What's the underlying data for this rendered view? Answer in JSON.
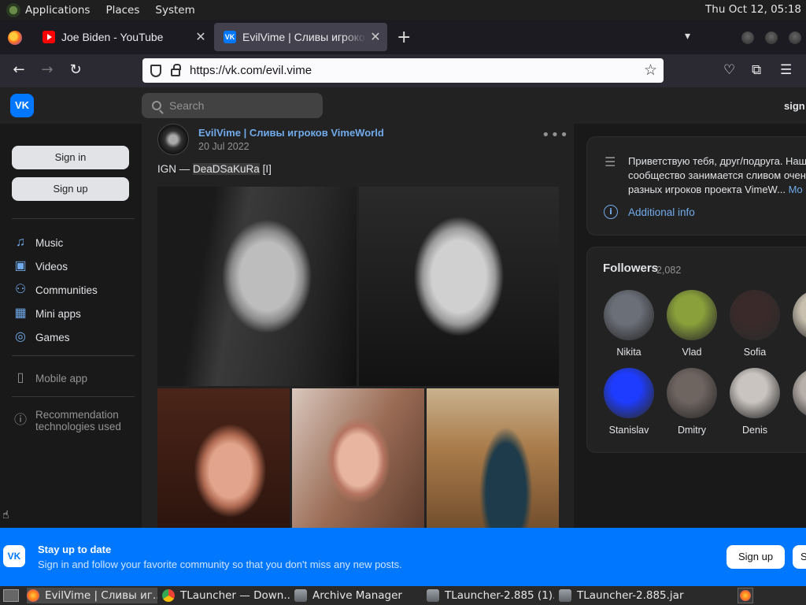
{
  "panel": {
    "menus": [
      "Applications",
      "Places",
      "System"
    ],
    "clock": "Thu Oct 12, 05:18"
  },
  "browser": {
    "tabs": [
      {
        "title": "Joe Biden - YouTube"
      },
      {
        "title": "EvilVime | Сливы игроков VimeWorld"
      }
    ],
    "url": "https://vk.com/evil.vime"
  },
  "vk": {
    "logo": "VK",
    "search_placeholder": "Search",
    "header_sign_in": "sign in",
    "sidebar": {
      "sign_in": "Sign in",
      "sign_up": "Sign up",
      "nav": [
        {
          "label": "Music",
          "icon": "music-icon"
        },
        {
          "label": "Videos",
          "icon": "video-icon"
        },
        {
          "label": "Communities",
          "icon": "users-icon"
        },
        {
          "label": "Mini apps",
          "icon": "grid-icon"
        },
        {
          "label": "Games",
          "icon": "gamepad-icon"
        }
      ],
      "mobile_app": "Mobile app",
      "recommendation": "Recommendation technologies used"
    },
    "post": {
      "author": "EvilVime | Сливы игроков VimeWorld",
      "date": "20 Jul 2022",
      "text_prefix": "IGN — ",
      "text_highlight": "DeaDSaKuRa",
      "text_suffix": " [I]"
    },
    "info": {
      "line1": "Приветствую тебя, друг/подруга. Наш",
      "line2": "сообщество занимается сливом очен",
      "line3": "разных игроков проекта VimeW...",
      "more": "Mo",
      "additional_info": "Additional info"
    },
    "followers": {
      "title": "Followers",
      "count": "2,082",
      "people": [
        {
          "name": "Nikita",
          "color": "#6b6f78"
        },
        {
          "name": "Vlad",
          "color": "#8aa03a"
        },
        {
          "name": "Sofia",
          "color": "#3a2a2a"
        },
        {
          "name": "E",
          "color": "#c9c0b0"
        },
        {
          "name": "Stanislav",
          "color": "#1e3cff"
        },
        {
          "name": "Dmitry",
          "color": "#6e6460"
        },
        {
          "name": "Denis",
          "color": "#c9c4c0"
        },
        {
          "name": "C",
          "color": "#b8b0aa"
        }
      ]
    },
    "banner": {
      "title": "Stay up to date",
      "subtitle": "Sign in and follow your favorite community so that you don't miss any new posts.",
      "sign_up": "Sign up",
      "sign_in": "S"
    }
  },
  "taskbar": {
    "tasks": [
      {
        "label": "EvilVime | Сливы иг...",
        "icon": "firefox-icon"
      },
      {
        "label": "TLauncher — Down...",
        "icon": "chrome-icon"
      },
      {
        "label": "Archive Manager",
        "icon": "archive-icon"
      },
      {
        "label": "TLauncher-2.885 (1)....",
        "icon": "archive-icon"
      },
      {
        "label": "TLauncher-2.885.jar",
        "icon": "archive-icon"
      }
    ]
  }
}
